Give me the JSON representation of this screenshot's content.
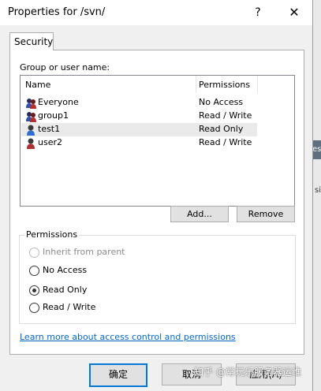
{
  "window": {
    "title": "Properties for /svn/",
    "help_glyph": "?",
    "close_glyph": "✕"
  },
  "tab": {
    "label": "Security"
  },
  "group_user": {
    "label": "Group or user name:",
    "col_name": "Name",
    "col_permissions": "Permissions",
    "rows": [
      {
        "name": "Everyone",
        "permission": "No Access",
        "icon": "group-icon"
      },
      {
        "name": "group1",
        "permission": "Read / Write",
        "icon": "group-icon"
      },
      {
        "name": "test1",
        "permission": "Read Only",
        "icon": "user-icon",
        "selected": true
      },
      {
        "name": "user2",
        "permission": "Read / Write",
        "icon": "user-icon"
      }
    ]
  },
  "buttons": {
    "add": "Add...",
    "remove": "Remove"
  },
  "permissions": {
    "label": "Permissions",
    "options": [
      {
        "label": "Inherit from parent",
        "disabled": true,
        "checked": false
      },
      {
        "label": "No Access",
        "disabled": false,
        "checked": false
      },
      {
        "label": "Read Only",
        "disabled": false,
        "checked": true
      },
      {
        "label": "Read / Write",
        "disabled": false,
        "checked": false
      }
    ]
  },
  "link": "Learn more about access control and permissions",
  "footer": {
    "ok": "确定",
    "cancel": "取消",
    "apply": "应用(A)"
  },
  "background": {
    "frag1": "es",
    "frag2": "sit"
  },
  "watermark": "知乎 @常玩乐服务器运维"
}
